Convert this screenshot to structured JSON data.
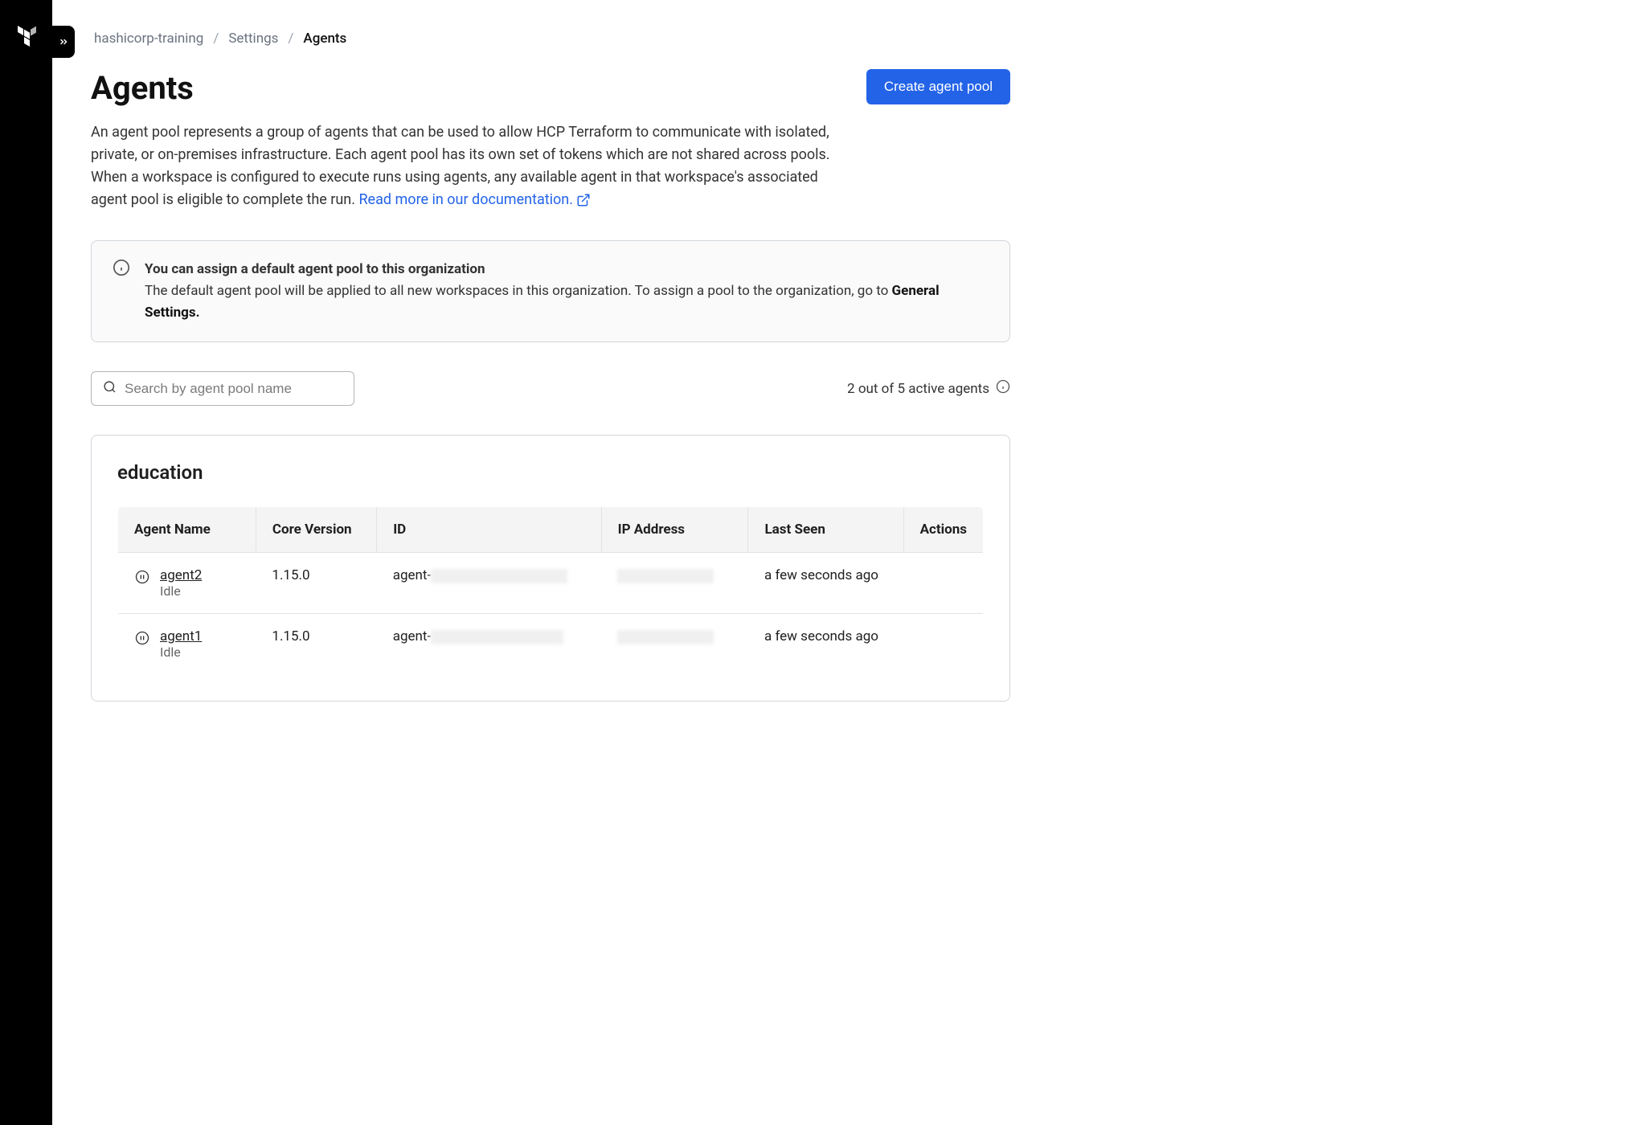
{
  "breadcrumb": {
    "org": "hashicorp-training",
    "section": "Settings",
    "page": "Agents"
  },
  "header": {
    "title": "Agents",
    "create_label": "Create agent pool"
  },
  "description": {
    "text": "An agent pool represents a group of agents that can be used to allow HCP Terraform to communicate with isolated, private, or on-premises infrastructure. Each agent pool has its own set of tokens which are not shared across pools. When a workspace is configured to execute runs using agents, any available agent in that workspace's associated agent pool is eligible to complete the run. ",
    "link_label": "Read more in our documentation."
  },
  "info_banner": {
    "title": "You can assign a default agent pool to this organization",
    "body": "The default agent pool will be applied to all new workspaces in this organization. To assign a pool to the organization, go to ",
    "link": "General Settings."
  },
  "search": {
    "placeholder": "Search by agent pool name"
  },
  "agent_count": "2 out of 5 active agents",
  "pool": {
    "name": "education",
    "columns": {
      "name": "Agent Name",
      "core": "Core Version",
      "id": "ID",
      "ip": "IP Address",
      "seen": "Last Seen",
      "actions": "Actions"
    },
    "agents": [
      {
        "name": "agent2",
        "status": "Idle",
        "core": "1.15.0",
        "id_prefix": "agent-",
        "last_seen": "a few seconds ago"
      },
      {
        "name": "agent1",
        "status": "Idle",
        "core": "1.15.0",
        "id_prefix": "agent-",
        "last_seen": "a few seconds ago"
      }
    ]
  }
}
